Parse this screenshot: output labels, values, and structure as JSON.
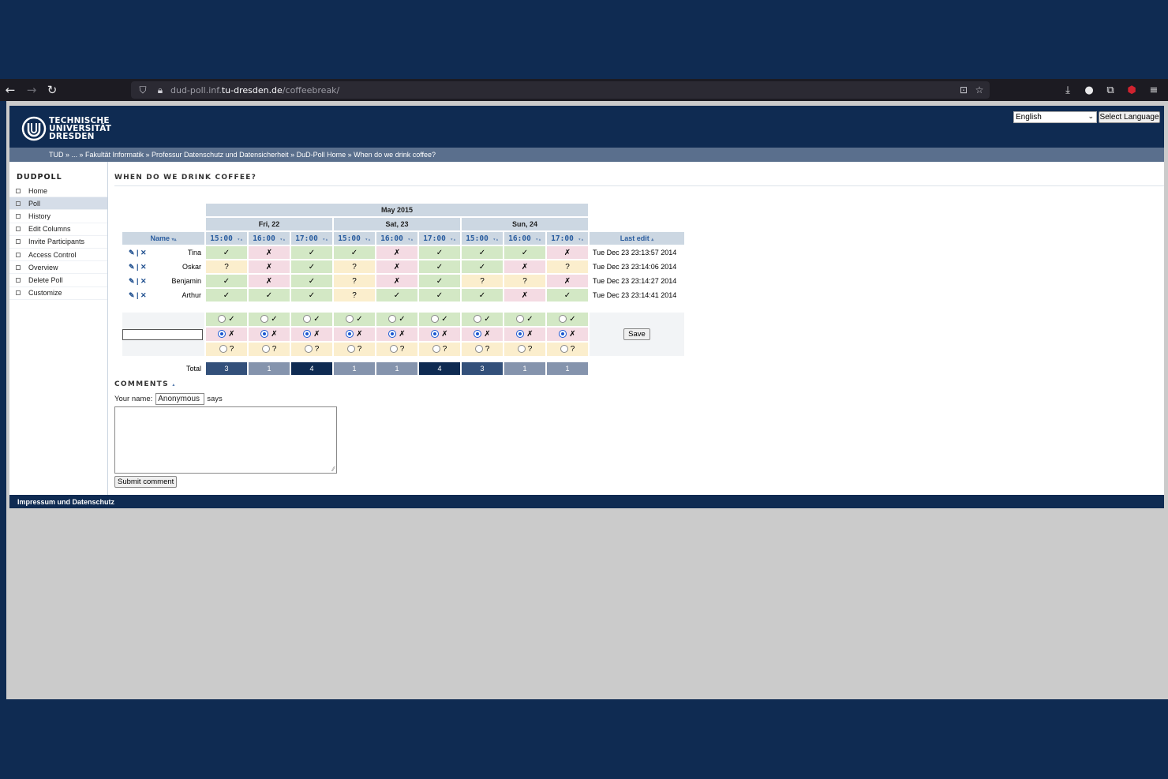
{
  "browser": {
    "url_prefix": "dud-poll.inf.",
    "url_host": "tu-dresden.de",
    "url_path": "/coffeebreak/"
  },
  "header": {
    "logo_line1": "TECHNISCHE",
    "logo_line2": "UNIVERSITÄT",
    "logo_line3": "DRESDEN",
    "language_selected": "English",
    "language_button": "Select Language"
  },
  "breadcrumb": "TUD » ... » Fakultät Informatik » Professur Datenschutz und Datensicherheit » DuD-Poll Home » When do we drink coffee?",
  "sidebar": {
    "title": "DUDPOLL",
    "items": [
      {
        "label": "Home"
      },
      {
        "label": "Poll"
      },
      {
        "label": "History"
      },
      {
        "label": "Edit Columns"
      },
      {
        "label": "Invite Participants"
      },
      {
        "label": "Access Control"
      },
      {
        "label": "Overview"
      },
      {
        "label": "Delete Poll"
      },
      {
        "label": "Customize"
      }
    ]
  },
  "poll": {
    "title": "WHEN DO WE DRINK COFFEE?",
    "month": "May 2015",
    "days": [
      "Fri, 22",
      "Sat, 23",
      "Sun, 24"
    ],
    "name_header": "Name",
    "lastedit_header": "Last edit",
    "sort_arrows": "▾▴",
    "sort_arrow_up": "▴",
    "times": [
      "15:00",
      "16:00",
      "17:00",
      "15:00",
      "16:00",
      "17:00",
      "15:00",
      "16:00",
      "17:00"
    ],
    "edit_icons": "✎ | ✕",
    "participants": [
      {
        "name": "Tina",
        "votes": [
          "✓",
          "✗",
          "✓",
          "✓",
          "✗",
          "✓",
          "✓",
          "✓",
          "✗"
        ],
        "last_edit": "Tue Dec 23 23:13:57 2014"
      },
      {
        "name": "Oskar",
        "votes": [
          "?",
          "✗",
          "✓",
          "?",
          "✗",
          "✓",
          "✓",
          "✗",
          "?"
        ],
        "last_edit": "Tue Dec 23 23:14:06 2014"
      },
      {
        "name": "Benjamin",
        "votes": [
          "✓",
          "✗",
          "✓",
          "?",
          "✗",
          "✓",
          "?",
          "?",
          "✗"
        ],
        "last_edit": "Tue Dec 23 23:14:27 2014"
      },
      {
        "name": "Arthur",
        "votes": [
          "✓",
          "✓",
          "✓",
          "?",
          "✓",
          "✓",
          "✓",
          "✗",
          "✓"
        ],
        "last_edit": "Tue Dec 23 23:14:41 2014"
      }
    ],
    "option_yes": "✓",
    "option_no": "✗",
    "option_maybe": "?",
    "selected_option": "no",
    "save_label": "Save",
    "total_label": "Total",
    "totals": [
      "3",
      "1",
      "4",
      "1",
      "1",
      "4",
      "3",
      "1",
      "1"
    ]
  },
  "comments": {
    "title": "COMMENTS",
    "your_name_label": "Your name:",
    "your_name_value": "Anonymous",
    "says": "says",
    "submit_label": "Submit comment"
  },
  "footer": "Impressum und Datenschutz"
}
